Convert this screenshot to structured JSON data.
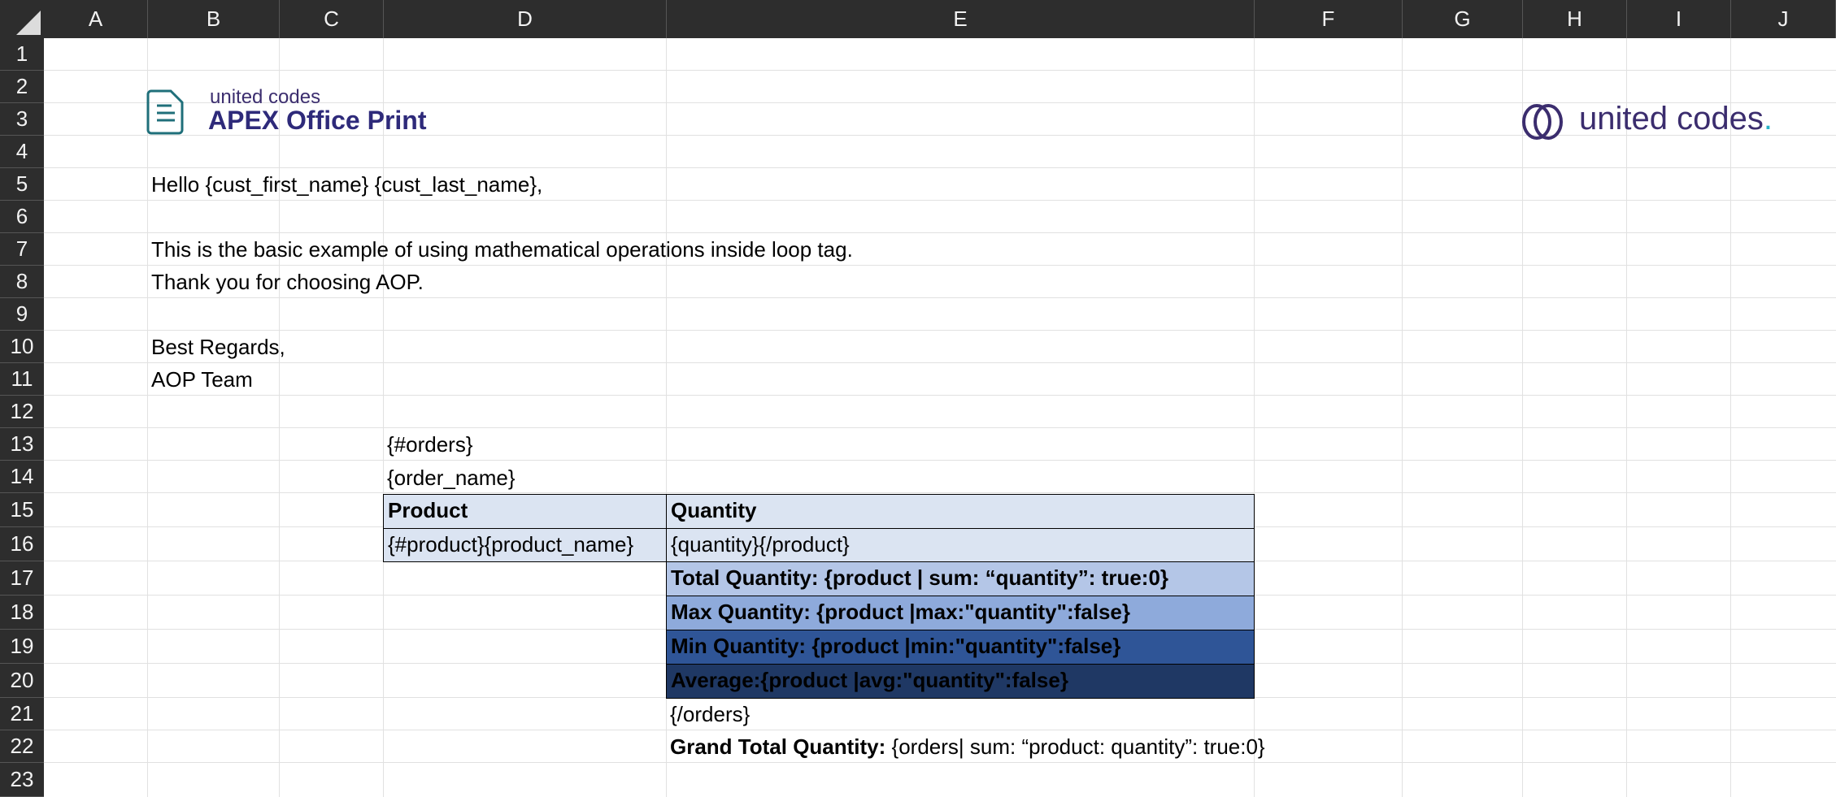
{
  "columns": [
    "A",
    "B",
    "C",
    "D",
    "E",
    "F",
    "G",
    "H",
    "I",
    "J"
  ],
  "rows": [
    "1",
    "2",
    "3",
    "4",
    "5",
    "6",
    "7",
    "8",
    "9",
    "10",
    "11",
    "12",
    "13",
    "14",
    "15",
    "16",
    "17",
    "18",
    "19",
    "20",
    "21",
    "22",
    "23"
  ],
  "logo_left": {
    "small": "united codes",
    "big": "APEX Office Print"
  },
  "logo_right": {
    "word": "united codes",
    "dot": "."
  },
  "lines": {
    "greeting": "Hello {cust_first_name} {cust_last_name},",
    "intro": "This is the basic example of using mathematical operations inside loop tag.",
    "thanks": "Thank you for choosing AOP.",
    "regards": "Best Regards,",
    "team": "AOP Team",
    "orders_open": "{#orders}",
    "order_name": "{order_name}",
    "orders_close": "{/orders}"
  },
  "table": {
    "header_product": "Product",
    "header_quantity": "Quantity",
    "row_product": "{#product}{product_name}",
    "row_quantity": "{quantity}{/product}",
    "total": "Total Quantity: {product | sum: “quantity”: true:0}",
    "max": "Max Quantity: {product |max:\"quantity\":false}",
    "min": "Min Quantity: {product |min:\"quantity\":false}",
    "avg": "Average:{product |avg:\"quantity\":false}"
  },
  "grand_total": {
    "label": "Grand Total Quantity:",
    "expr": " {orders| sum: “product: quantity”: true:0}"
  },
  "colors": {
    "header_fill": "#dbe4f2",
    "total_fill": "#b4c6e7",
    "max_fill": "#8eaadb",
    "min_fill": "#2f5597",
    "avg_fill": "#1f3864",
    "header_bar": "#2d2d2d",
    "brand": "#3b2d6e"
  },
  "icons": {
    "aop_logo": "document-icon",
    "uc_logo": "rings-icon",
    "select_all": "select-all-triangle-icon"
  }
}
